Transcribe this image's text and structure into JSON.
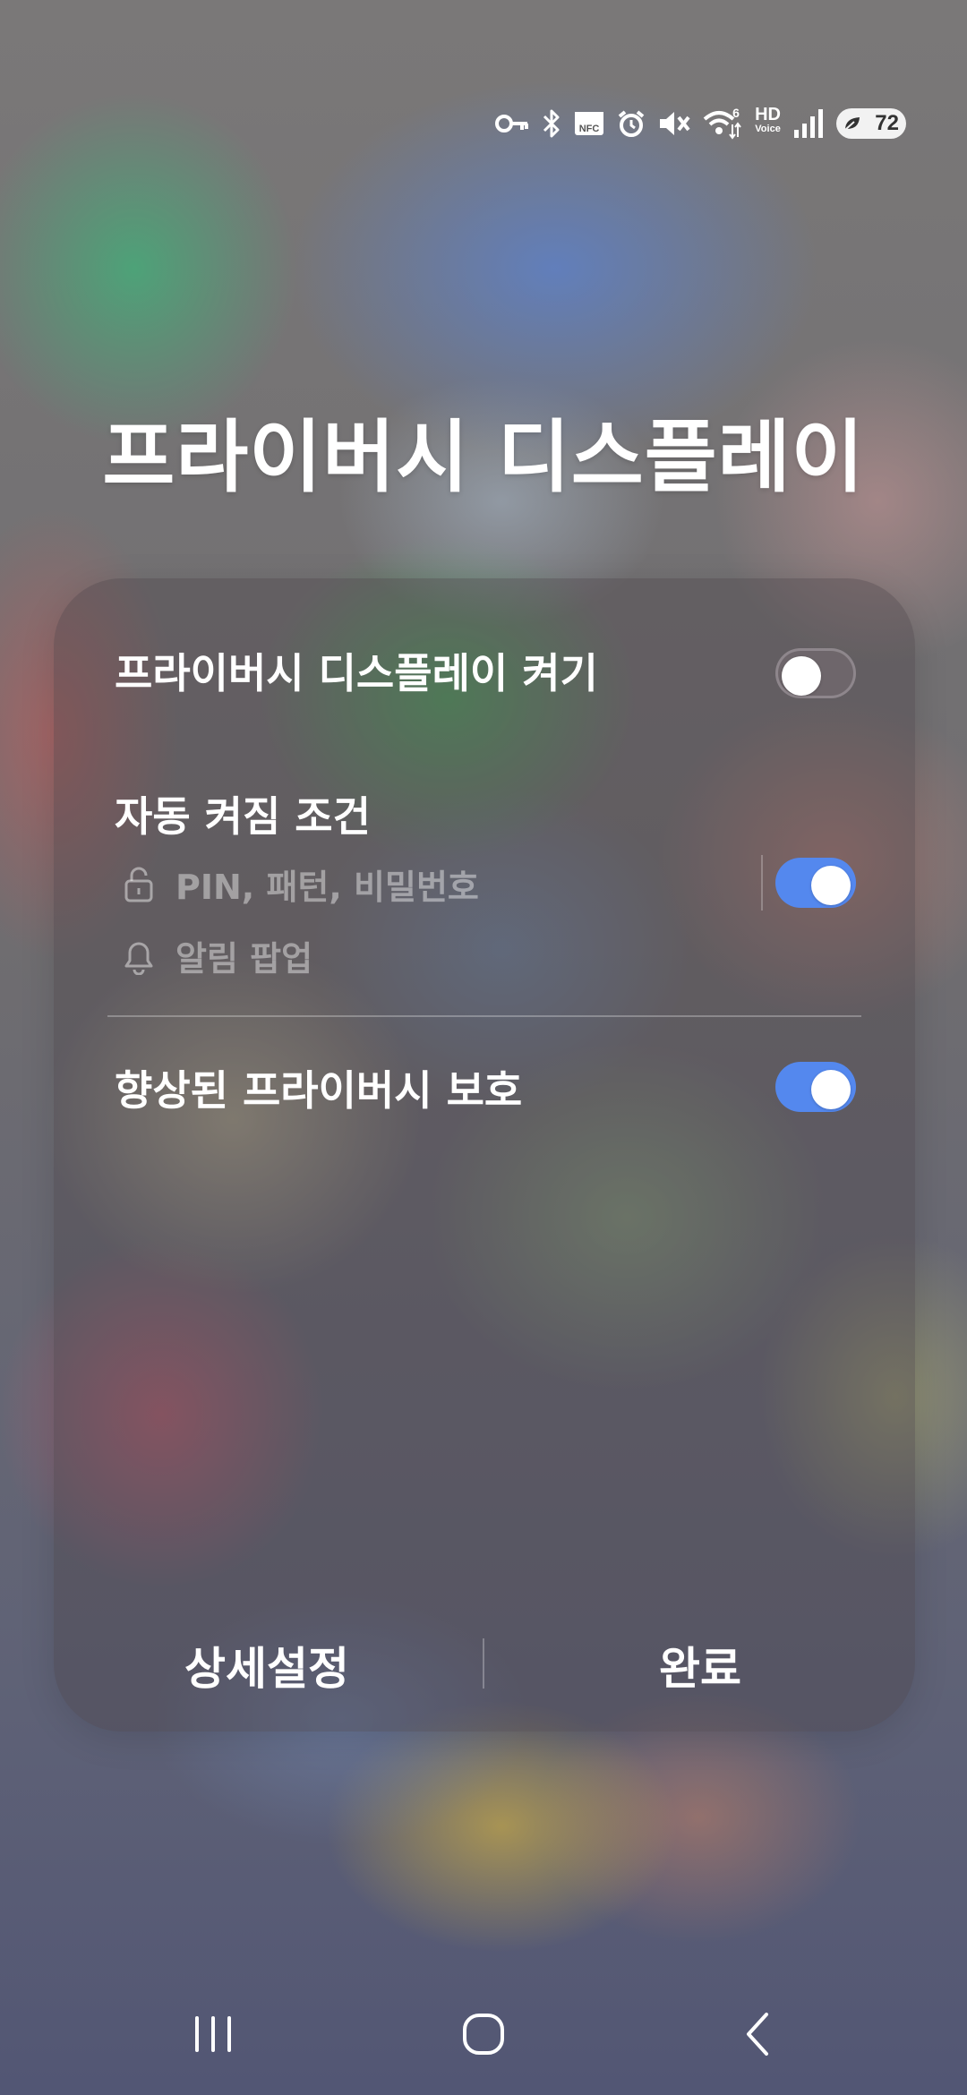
{
  "status_bar": {
    "icons": [
      "key-icon",
      "bluetooth-icon",
      "nfc-icon",
      "alarm-icon",
      "mute-icon",
      "wifi-icon",
      "hd-voice-icon",
      "signal-icon",
      "battery-icon"
    ],
    "nfc_text": "NFC",
    "wifi_badge": "6",
    "hd_text": "HD",
    "voice_text": "Voice",
    "battery_level": "72"
  },
  "title": "프라이버시 디스플레이",
  "panel": {
    "enable_label": "프라이버시 디스플레이 켜기",
    "enable_on": false,
    "auto_section_title": "자동 켜짐 조건",
    "conditions": [
      {
        "icon": "lock-icon",
        "label": "PIN, 패턴, 비밀번호"
      },
      {
        "icon": "bell-icon",
        "label": "알림 팝업"
      }
    ],
    "auto_on": true,
    "enhanced_label": "향상된 프라이버시 보호",
    "enhanced_on": true,
    "details_button": "상세설정",
    "done_button": "완료"
  },
  "nav": {
    "recents": "recents-icon",
    "home": "home-icon",
    "back": "back-icon"
  },
  "colors": {
    "toggle_on": "#5488ee",
    "text": "#ffffff"
  }
}
